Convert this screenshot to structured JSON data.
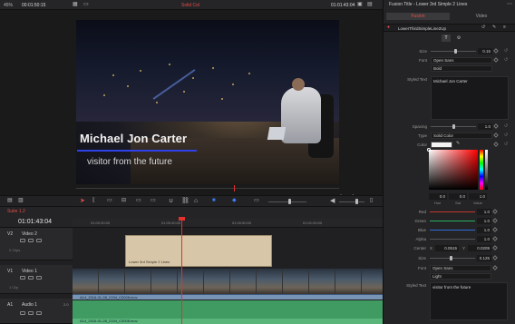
{
  "topbar": {
    "zoom": "45%",
    "source_timecode": "00:01:50:15",
    "timeline_name": "Solid Col",
    "record_timecode": "01:01:43:04",
    "inspector_title": "Fusion Title - Lower 3rd Simple 2 Lines"
  },
  "viewer": {
    "title_name": "Michael Jon Carter",
    "title_sub": "visitor from the future"
  },
  "timeline": {
    "name": "Suite 1.2",
    "timecode": "01:01:43:04",
    "ruler_ticks": [
      "01:00:30:00",
      "01:00:40:00",
      "01:00:50:00",
      "01:01:00:00"
    ],
    "tracks": [
      {
        "id": "V2",
        "name": "Video 2",
        "clips": "0 Clips"
      },
      {
        "id": "V1",
        "name": "Video 1",
        "clips": "1 Clip"
      },
      {
        "id": "A1",
        "name": "Audio 1",
        "level": "2.0"
      }
    ],
    "v2_clip": "Lower 3rd Simple 2 Lines",
    "v1_clip": "A14_2016-01-28_2154_C0008.mov",
    "a1_clip": "A14_2016-01-28_2154_C0008.mov"
  },
  "inspector": {
    "tabs": [
      "Fusion",
      "Video"
    ],
    "layer": "LowerThirdSimpleLine2Up",
    "size1": {
      "label": "Size",
      "value": "0.15",
      "fraction": 0.55
    },
    "font1": {
      "label": "Font",
      "value": "Open Sans",
      "style": "Bold"
    },
    "styled_text_label": "Styled Text",
    "styled_text_1": "Michael Jon Carter",
    "spacing": {
      "label": "Spacing",
      "value": "1.0",
      "fraction": 0.5
    },
    "type": {
      "label": "Type",
      "value": "Solid Color"
    },
    "color_label": "Color",
    "hsv": {
      "h": "0.0",
      "s": "0.0",
      "v": "1.0",
      "h_label": "Hue",
      "s_label": "Sat",
      "v_label": "Value"
    },
    "red": {
      "label": "Red",
      "value": "1.0"
    },
    "green": {
      "label": "Green",
      "value": "1.0"
    },
    "blue": {
      "label": "Blue",
      "value": "1.0"
    },
    "alpha": {
      "label": "Alpha",
      "value": "1.0"
    },
    "center": {
      "label": "Center",
      "x_label": "X",
      "x": "0.0515",
      "y_label": "Y",
      "y": "0.0209"
    },
    "size2": {
      "label": "Size",
      "value": "0.125",
      "fraction": 0.45
    },
    "font2": {
      "label": "Font",
      "value": "Open Sans",
      "style": "Light"
    },
    "styled_text_2": "visitor from the future"
  },
  "colors": {
    "accent": "#e24d48",
    "title_underline": "#2f41e8",
    "video_clip": "#7794b6",
    "audio_clip": "#3f9b62",
    "title_clip": "#d8c6a8"
  }
}
